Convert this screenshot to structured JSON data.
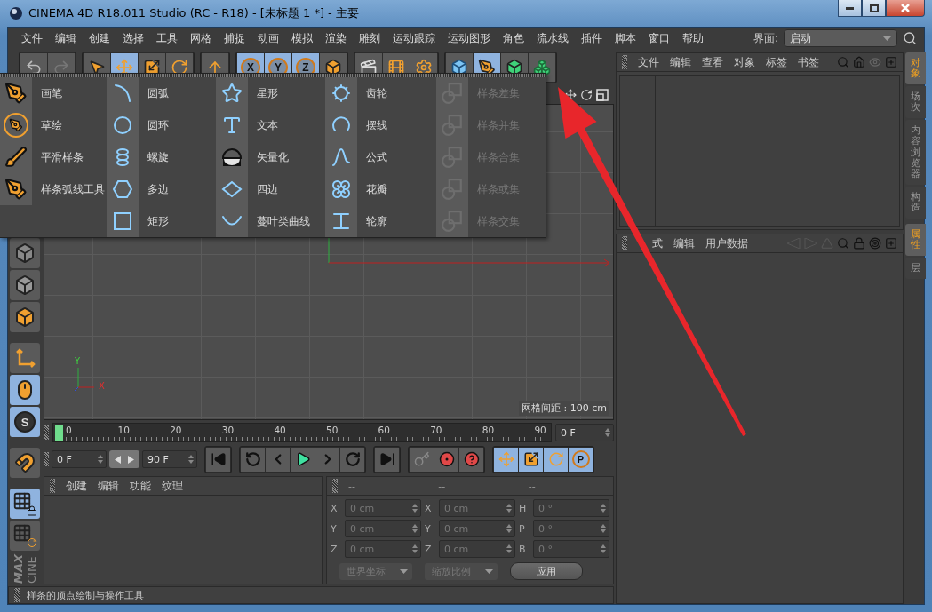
{
  "window": {
    "title": "CINEMA 4D R18.011 Studio (RC - R18) - [未标题 1 *] - 主要"
  },
  "menu_bar": [
    "文件",
    "编辑",
    "创建",
    "选择",
    "工具",
    "网格",
    "捕捉",
    "动画",
    "模拟",
    "渲染",
    "雕刻",
    "运动跟踪",
    "运动图形",
    "角色",
    "流水线",
    "插件",
    "脚本",
    "窗口",
    "帮助"
  ],
  "layout": {
    "label": "界面:",
    "value": "启动"
  },
  "toolbar": [
    {
      "items": [
        {
          "kind": "undo",
          "selected": false
        },
        {
          "kind": "redo",
          "selected": false
        }
      ]
    },
    {
      "items": [
        {
          "kind": "select",
          "selected": false
        },
        {
          "kind": "move",
          "selected": true
        },
        {
          "kind": "scale",
          "selected": false
        },
        {
          "kind": "rotate",
          "selected": false
        }
      ]
    },
    {
      "items": [
        {
          "kind": "axismove",
          "selected": false
        }
      ]
    },
    {
      "items": [
        {
          "kind": "axis",
          "label": "X",
          "selected": true
        },
        {
          "kind": "axis",
          "label": "Y",
          "selected": true
        },
        {
          "kind": "axis",
          "label": "Z",
          "selected": true
        },
        {
          "kind": "coords",
          "selected": false
        }
      ]
    },
    {
      "items": [
        {
          "kind": "renderview",
          "selected": false
        },
        {
          "kind": "render",
          "selected": false
        },
        {
          "kind": "rendersettings",
          "selected": false
        }
      ]
    },
    {
      "items": [
        {
          "kind": "cube",
          "selected": false
        },
        {
          "kind": "pen",
          "selected": true
        },
        {
          "kind": "subdivide",
          "selected": false
        },
        {
          "kind": "cloner",
          "selected": false
        }
      ]
    }
  ],
  "spline_menu": {
    "columns": [
      [
        {
          "kind": "pen",
          "label": "画笔",
          "disabled": false
        },
        {
          "kind": "sketch",
          "label": "草绘",
          "disabled": false
        },
        {
          "kind": "smooth",
          "label": "平滑样条",
          "disabled": false
        },
        {
          "kind": "arctool",
          "label": "样条弧线工具",
          "disabled": false
        }
      ],
      [
        {
          "kind": "arc",
          "label": "圆弧",
          "disabled": false
        },
        {
          "kind": "circle",
          "label": "圆环",
          "disabled": false
        },
        {
          "kind": "helix",
          "label": "螺旋",
          "disabled": false
        },
        {
          "kind": "polygon",
          "label": "多边",
          "disabled": false
        },
        {
          "kind": "rectangle",
          "label": "矩形",
          "disabled": false
        }
      ],
      [
        {
          "kind": "star",
          "label": "星形",
          "disabled": false
        },
        {
          "kind": "text",
          "label": "文本",
          "disabled": false
        },
        {
          "kind": "vectorize",
          "label": "矢量化",
          "disabled": false
        },
        {
          "kind": "diamond",
          "label": "四边",
          "disabled": false
        },
        {
          "kind": "cissoid",
          "label": "蔓叶类曲线",
          "disabled": false
        }
      ],
      [
        {
          "kind": "cog",
          "label": "齿轮",
          "disabled": false
        },
        {
          "kind": "cycloid",
          "label": "摆线",
          "disabled": false
        },
        {
          "kind": "formula",
          "label": "公式",
          "disabled": false
        },
        {
          "kind": "flower",
          "label": "花瓣",
          "disabled": false
        },
        {
          "kind": "profile",
          "label": "轮廓",
          "disabled": false
        }
      ],
      [
        {
          "kind": "boolean",
          "label": "样条差集",
          "disabled": true
        },
        {
          "kind": "boolean",
          "label": "样条并集",
          "disabled": true
        },
        {
          "kind": "boolean",
          "label": "样条合集",
          "disabled": true
        },
        {
          "kind": "boolean",
          "label": "样条或集",
          "disabled": true
        },
        {
          "kind": "boolean",
          "label": "样条交集",
          "disabled": true
        }
      ]
    ]
  },
  "left_tools": [
    {
      "kind": "points",
      "selected": false
    },
    {
      "kind": "edges",
      "selected": false
    },
    {
      "kind": "polygons",
      "selected": false
    },
    {
      "kind": "axis",
      "selected": false
    },
    {
      "kind": "tweak",
      "selected": true
    },
    {
      "kind": "snap",
      "label": "S",
      "selected": true
    },
    {
      "kind": "magnet",
      "selected": false
    },
    {
      "kind": "planelock",
      "selected": true
    },
    {
      "kind": "plane",
      "selected": false
    }
  ],
  "logo": [
    "MAX",
    "CINE"
  ],
  "viewport": {
    "axis_labels": [
      "Y",
      "X"
    ],
    "grid_spacing": "网格间距 : 100 cm"
  },
  "timeline": {
    "ticks": [
      "0",
      "10",
      "20",
      "30",
      "40",
      "50",
      "60",
      "70",
      "80",
      "90"
    ],
    "level": 0,
    "frame": "0 F"
  },
  "transport": {
    "start": "0 F",
    "end": "90 F",
    "groups": [
      [
        {
          "kind": "first",
          "selected": false
        }
      ],
      [
        {
          "kind": "prevkey",
          "selected": false
        },
        {
          "kind": "prevframe",
          "selected": false
        },
        {
          "kind": "play",
          "selected": false
        },
        {
          "kind": "nextframe",
          "selected": false
        },
        {
          "kind": "nextkey",
          "selected": false
        }
      ],
      [
        {
          "kind": "last",
          "selected": false
        }
      ],
      [
        {
          "kind": "key",
          "selected": false
        },
        {
          "kind": "record",
          "selected": false
        },
        {
          "kind": "help",
          "selected": false
        }
      ],
      [
        {
          "kind": "move",
          "selected": true
        },
        {
          "kind": "scale",
          "selected": true
        },
        {
          "kind": "rotate",
          "selected": true
        },
        {
          "kind": "param",
          "label": "P",
          "selected": true
        }
      ]
    ]
  },
  "material_manager": {
    "menu": [
      "创建",
      "编辑",
      "功能",
      "纹理"
    ]
  },
  "coordinates": {
    "headers": [
      "--",
      "--",
      "--"
    ],
    "disabled": true,
    "columns": [
      [
        {
          "axis": "X",
          "value": "0 cm"
        },
        {
          "axis": "Y",
          "value": "0 cm"
        },
        {
          "axis": "Z",
          "value": "0 cm"
        }
      ],
      [
        {
          "axis": "X",
          "value": "0 cm"
        },
        {
          "axis": "Y",
          "value": "0 cm"
        },
        {
          "axis": "Z",
          "value": "0 cm"
        }
      ],
      [
        {
          "axis": "H",
          "value": "0 °"
        },
        {
          "axis": "P",
          "value": "0 °"
        },
        {
          "axis": "B",
          "value": "0 °"
        }
      ]
    ],
    "dropdowns": [
      "世界坐标",
      "缩放比例"
    ],
    "apply": "应用"
  },
  "object_manager": {
    "menu": [
      "文件",
      "编辑",
      "查看",
      "对象",
      "标签",
      "书签"
    ]
  },
  "attribute_manager": {
    "menu": [
      "式",
      "编辑",
      "用户数据"
    ]
  },
  "side_tabs": [
    {
      "label": "对象",
      "selected": true
    },
    {
      "label": "场次",
      "selected": false
    },
    {
      "label": "内容浏览器",
      "selected": false
    },
    {
      "label": "构造",
      "selected": false
    }
  ],
  "attribute_tabs": [
    {
      "label": "属性",
      "selected": true
    },
    {
      "label": "层",
      "selected": false
    }
  ],
  "status_bar": "样条的顶点绘制与操作工具"
}
